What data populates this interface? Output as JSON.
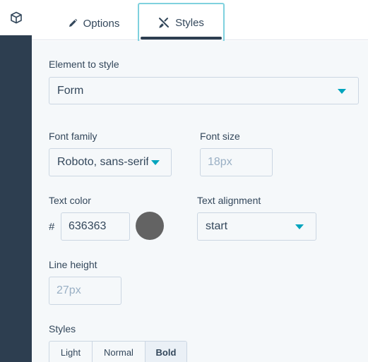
{
  "tabs": {
    "options_label": "Options",
    "styles_label": "Styles",
    "active": "Styles"
  },
  "element_to_style": {
    "label": "Element to style",
    "value": "Form"
  },
  "font_family": {
    "label": "Font family",
    "value": "Roboto, sans-serif"
  },
  "font_size": {
    "label": "Font size",
    "placeholder": "18px"
  },
  "text_color": {
    "label": "Text color",
    "prefix": "#",
    "value": "636363",
    "swatch_color": "#636363"
  },
  "text_alignment": {
    "label": "Text alignment",
    "value": "start"
  },
  "line_height": {
    "label": "Line height",
    "placeholder": "27px"
  },
  "styles": {
    "label": "Styles",
    "options": [
      "Light",
      "Normal",
      "Bold"
    ],
    "selected": "Bold"
  },
  "icons": {
    "rail": "cube-icon",
    "options_tab": "pencil-icon",
    "styles_tab": "brush-icon",
    "select_caret": "chevron-down-icon"
  },
  "colors": {
    "accent": "#00a4bd",
    "rail": "#2d3e50",
    "text": "#33475b",
    "panel_bg": "#f5f8fa",
    "border": "#cbd6e2"
  }
}
